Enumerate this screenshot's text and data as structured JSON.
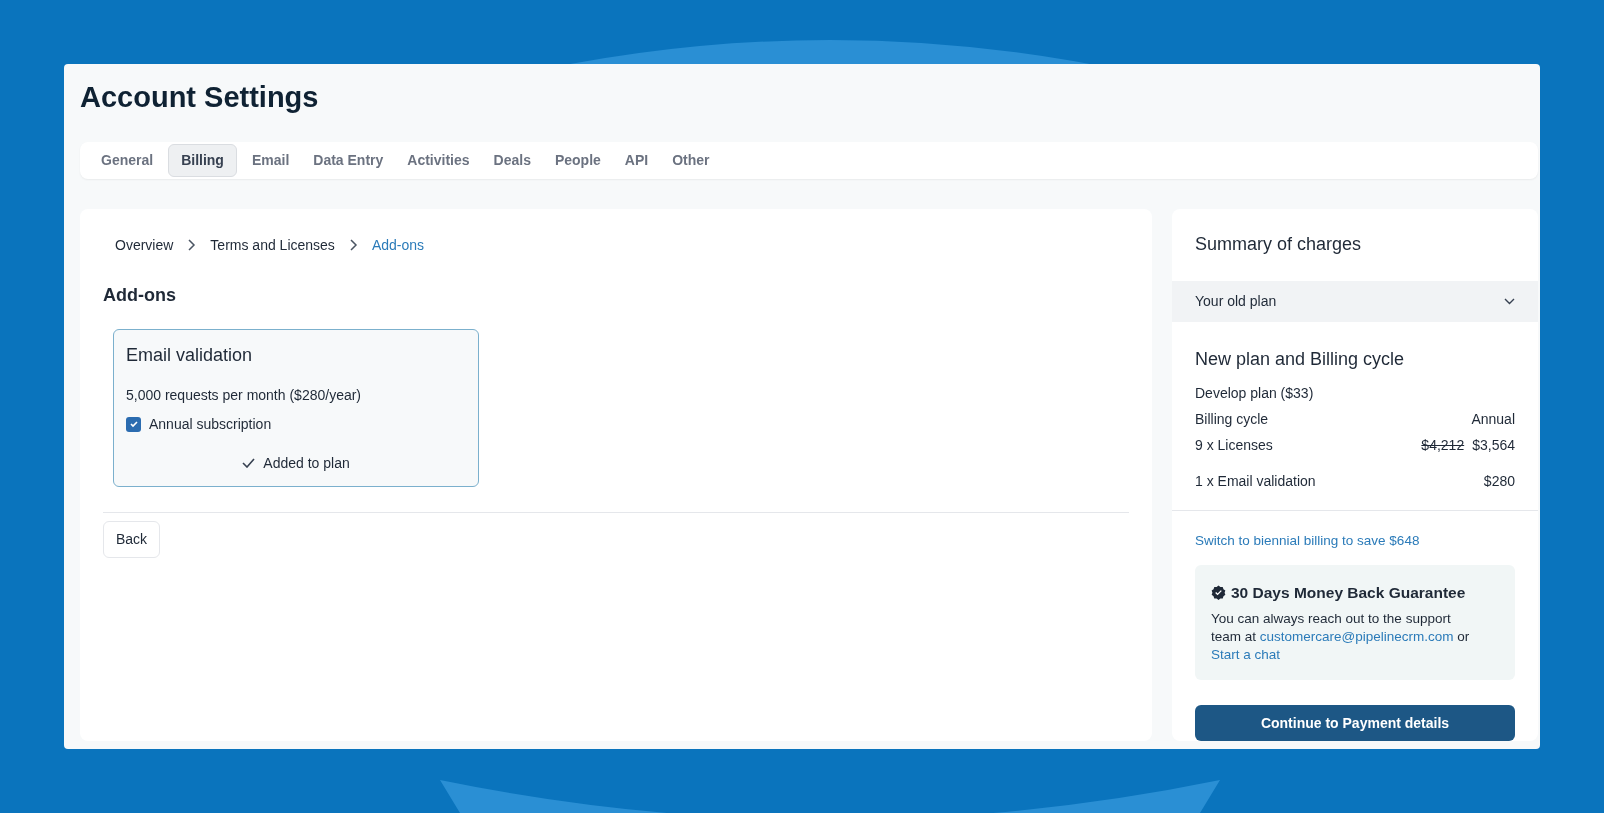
{
  "page": {
    "title": "Account Settings"
  },
  "tabs": [
    {
      "label": "General",
      "selected": false
    },
    {
      "label": "Billing",
      "selected": true
    },
    {
      "label": "Email",
      "selected": false
    },
    {
      "label": "Data Entry",
      "selected": false
    },
    {
      "label": "Activities",
      "selected": false
    },
    {
      "label": "Deals",
      "selected": false
    },
    {
      "label": "People",
      "selected": false
    },
    {
      "label": "API",
      "selected": false
    },
    {
      "label": "Other",
      "selected": false
    }
  ],
  "breadcrumbs": [
    {
      "label": "Overview",
      "selected": false
    },
    {
      "label": "Terms and Licenses",
      "selected": false
    },
    {
      "label": "Add-ons",
      "selected": true
    }
  ],
  "section_title": "Add-ons",
  "addons": [
    {
      "title": "Email validation",
      "description": "5,000 requests per month ($280/year)",
      "option": {
        "label": "Annual subscription",
        "checked": true
      },
      "status": "Added to plan"
    }
  ],
  "back_button": "Back",
  "summary": {
    "title": "Summary of charges",
    "old_plan": {
      "label": "Your old plan",
      "expanded": false
    },
    "new_plan_title": "New plan and Billing cycle",
    "lines": [
      {
        "label": "Develop plan ($33)"
      },
      {
        "label": "Billing cycle",
        "value": "Annual"
      },
      {
        "label": "9 x Licenses",
        "old_value": "$4,212",
        "value": "$3,564"
      },
      {
        "label": "1 x Email validation",
        "value": "$280"
      }
    ],
    "switch_link": "Switch to biennial billing to save $648",
    "guarantee": {
      "title": "30 Days Money Back Guarantee",
      "parts": [
        {
          "kind": "text",
          "text": "You can always reach out to the support team at "
        },
        {
          "kind": "link",
          "text": "customercare@pipelinecrm.com"
        },
        {
          "kind": "text",
          "text": " or "
        },
        {
          "kind": "link",
          "text": "Start a chat"
        }
      ]
    },
    "continue_button": "Continue to Payment details"
  }
}
